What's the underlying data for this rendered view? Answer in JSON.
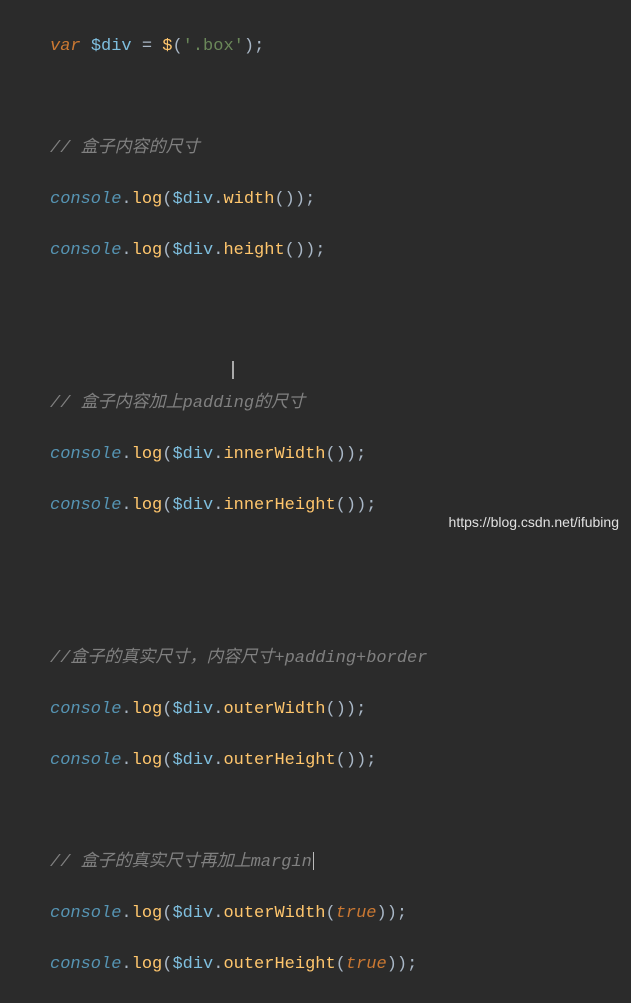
{
  "code": {
    "var_kw": "var",
    "div_var": "$div",
    "assign": " = ",
    "jq_fn": "$",
    "selector_str": "'.box'",
    "semi": ";",
    "comment1": "// 盒子内容的尺寸",
    "console": "console",
    "log": "log",
    "width": "width",
    "height": "height",
    "comment2": "// 盒子内容加上padding的尺寸",
    "innerWidth": "innerWidth",
    "innerHeight": "innerHeight",
    "comment3": "//盒子的真实尺寸，内容尺寸+padding+border",
    "outerWidth": "outerWidth",
    "outerHeight": "outerHeight",
    "comment4": "// 盒子的真实尺寸再加上margin",
    "true_kw": "true",
    "dot": ".",
    "open": "(",
    "close": ")",
    "open2": "((",
    "close2": "))"
  },
  "watermark": "https://blog.csdn.net/ifubing"
}
